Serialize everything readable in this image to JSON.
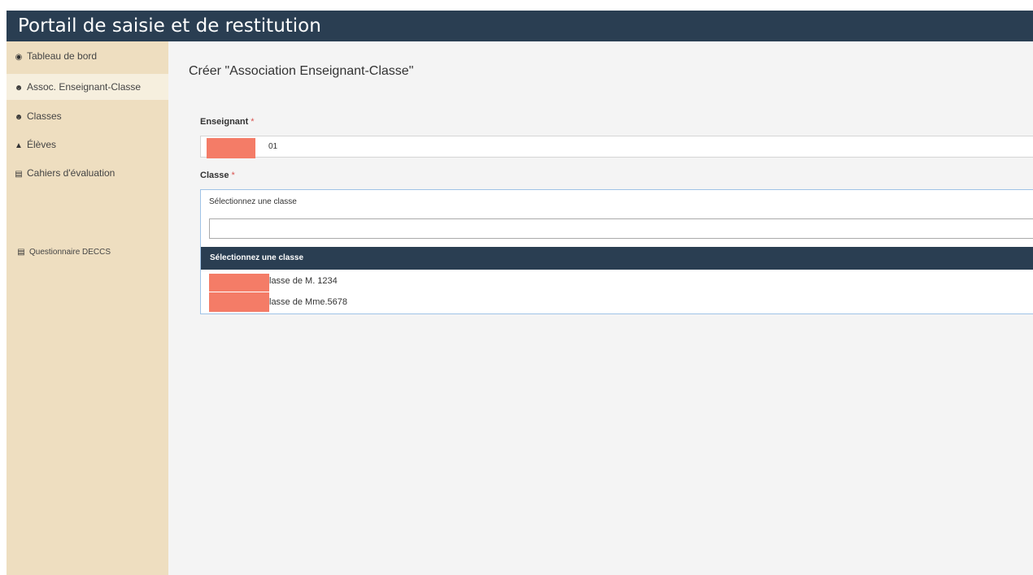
{
  "app": {
    "title": "Portail de saisie et de restitution"
  },
  "sidebar": {
    "items": [
      {
        "label": "Tableau de bord",
        "icon": "dashboard-icon"
      },
      {
        "label": "Assoc. Enseignant-Classe",
        "icon": "users-icon",
        "active": true
      },
      {
        "label": "Classes",
        "icon": "users-icon"
      },
      {
        "label": "Élèves",
        "icon": "graduation-cap-icon"
      },
      {
        "label": "Cahiers d'évaluation",
        "icon": "document-icon"
      }
    ],
    "extra_item": {
      "label": "Questionnaire DECCS",
      "icon": "document-icon"
    }
  },
  "page": {
    "title": "Créer \"Association Enseignant-Classe\""
  },
  "form": {
    "enseignant": {
      "label": "Enseignant",
      "required_mark": "*",
      "value_visible": "01"
    },
    "classe": {
      "label": "Classe",
      "required_mark": "*",
      "placeholder": "Sélectionnez une classe",
      "search_value": "",
      "dropdown_header": "Sélectionnez une classe",
      "options": [
        {
          "label_visible": "lasse de M. 1234"
        },
        {
          "label_visible": "lasse de Mme.5678"
        }
      ]
    }
  },
  "colors": {
    "header_bg": "#2a3e52",
    "sidebar_bg": "#eedec0",
    "sidebar_active_bg": "#f6efde",
    "redaction": "#f47c67",
    "required": "#d9534f"
  }
}
